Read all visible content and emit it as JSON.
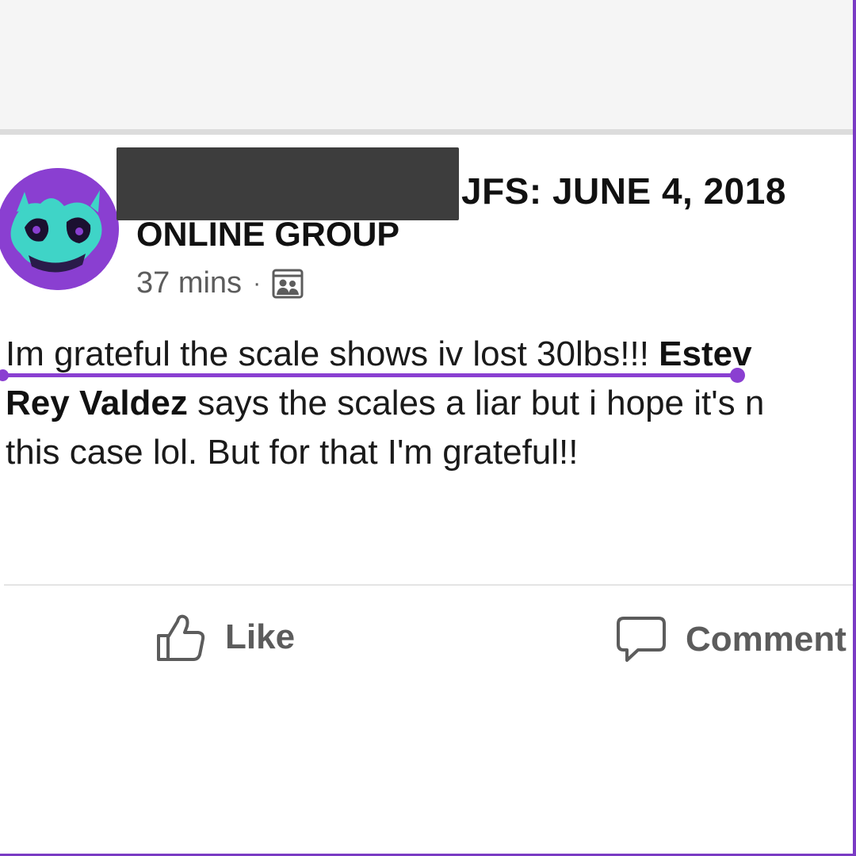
{
  "post": {
    "group_title_line1": "JFS: JUNE 4, 2018",
    "group_title_line2": "ONLINE GROUP",
    "time_ago": "37 mins",
    "separator": "·",
    "audience_icon": "group-icon",
    "body": {
      "line1_text": "Im grateful the scale shows iv lost 30lbs!!! ",
      "line1_mention": "Estev",
      "line2_mention": "Rey Valdez",
      "line2_text": " says the scales a liar but i hope it's n",
      "line3_text": "this case lol. But for that I'm grateful!!"
    }
  },
  "actions": {
    "like_label": "Like",
    "like_icon": "thumbs-up-icon",
    "comment_label": "Comment",
    "comment_icon": "speech-bubble-icon"
  },
  "colors": {
    "accent": "#8a3fd1",
    "text": "#1a1a1a",
    "muted": "#5c5c5c",
    "redaction": "#3d3d3d"
  }
}
